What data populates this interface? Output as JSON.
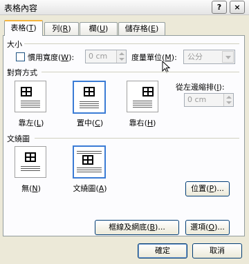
{
  "window": {
    "title": "表格內容",
    "help_button": "?",
    "close_button": "×"
  },
  "tabs": [
    {
      "label": "表格",
      "key": "T"
    },
    {
      "label": "列",
      "key": "R"
    },
    {
      "label": "欄",
      "key": "U"
    },
    {
      "label": "儲存格",
      "key": "E"
    }
  ],
  "size": {
    "section_label": "大小",
    "pref_width_label": "慣用寬度",
    "pref_width_key": "W",
    "pref_width_checked": false,
    "pref_width_value": "0 cm",
    "unit_label": "度量單位",
    "unit_key": "M",
    "unit_value": "公分"
  },
  "alignment": {
    "section_label": "對齊方式",
    "options": [
      {
        "label": "靠左",
        "key": "L",
        "selected": false
      },
      {
        "label": "置中",
        "key": "C",
        "selected": true
      },
      {
        "label": "靠右",
        "key": "H",
        "selected": false
      }
    ],
    "indent_label": "從左邊縮排",
    "indent_key": "I",
    "indent_value": "0 cm"
  },
  "wrapping": {
    "section_label": "文繞圖",
    "options": [
      {
        "label": "無",
        "key": "N",
        "selected": false
      },
      {
        "label": "文繞圖",
        "key": "A",
        "selected": true
      }
    ],
    "position_button": "位置",
    "position_key": "P"
  },
  "bottom": {
    "borders_button": "框線及網底",
    "borders_key": "B",
    "options_button": "選項",
    "options_key": "O",
    "ok_button": "確定",
    "cancel_button": "取消"
  }
}
